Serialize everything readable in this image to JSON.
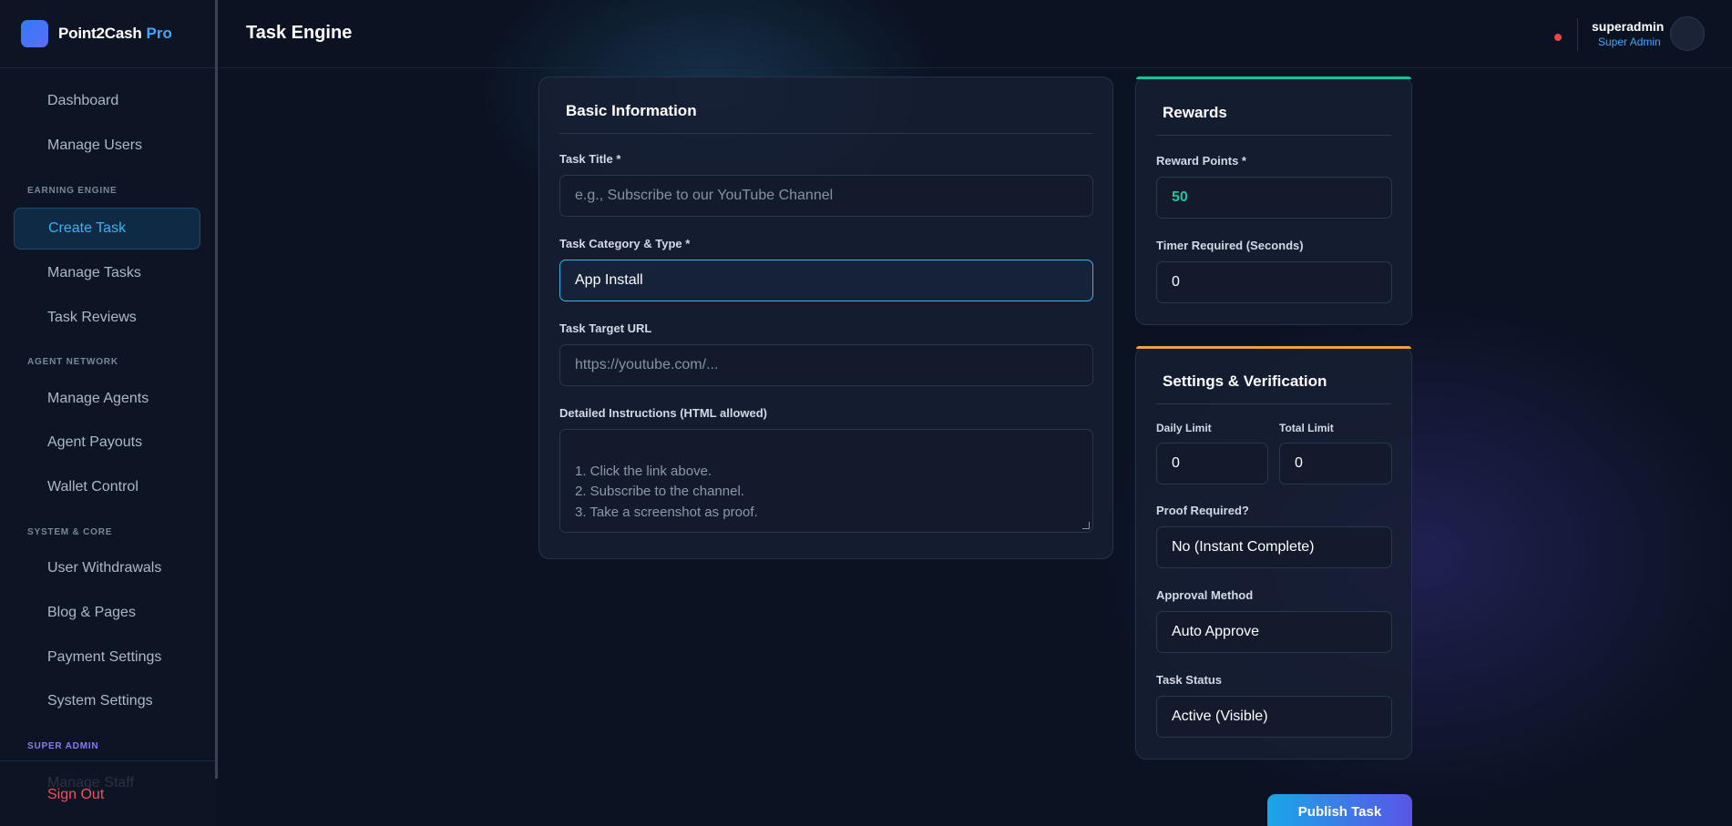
{
  "brand": {
    "name": "Point2Cash",
    "tag": "Pro"
  },
  "sidebar": {
    "items": [
      {
        "label": "Dashboard"
      },
      {
        "label": "Manage Users"
      },
      {
        "label": "Create Task"
      },
      {
        "label": "Manage Tasks"
      },
      {
        "label": "Task Reviews"
      },
      {
        "label": "Manage Agents"
      },
      {
        "label": "Agent Payouts"
      },
      {
        "label": "Wallet Control"
      },
      {
        "label": "User Withdrawals"
      },
      {
        "label": "Blog & Pages"
      },
      {
        "label": "Payment Settings"
      },
      {
        "label": "System Settings"
      }
    ],
    "sections": {
      "earning": "EARNING ENGINE",
      "agent": "AGENT NETWORK",
      "system": "SYSTEM & CORE",
      "super": "SUPER ADMIN"
    },
    "faded_item": "Manage Staff",
    "sign_out": "Sign Out"
  },
  "header": {
    "title": "Task Engine",
    "user_name": "superadmin",
    "user_role": "Super Admin"
  },
  "basic_info": {
    "title": "Basic Information",
    "task_title_label": "Task Title *",
    "task_title_placeholder": "e.g., Subscribe to our YouTube Channel",
    "category_label": "Task Category & Type *",
    "category_value": "App Install",
    "url_label": "Task Target URL",
    "url_placeholder": "https://youtube.com/...",
    "instructions_label": "Detailed Instructions (HTML allowed)",
    "instructions_placeholder": "1. Click the link above.\n2. Subscribe to the channel.\n3. Take a screenshot as proof."
  },
  "rewards": {
    "title": "Rewards",
    "points_label": "Reward Points *",
    "points_value": "50",
    "timer_label": "Timer Required (Seconds)",
    "timer_value": "0"
  },
  "settings": {
    "title": "Settings & Verification",
    "daily_limit_label": "Daily Limit",
    "daily_limit_value": "0",
    "total_limit_label": "Total Limit",
    "total_limit_value": "0",
    "proof_label": "Proof Required?",
    "proof_value": "No (Instant Complete)",
    "approval_label": "Approval Method",
    "approval_value": "Auto Approve",
    "status_label": "Task Status",
    "status_value": "Active (Visible)"
  },
  "actions": {
    "publish": "Publish Task"
  },
  "colors": {
    "accent": "#36b5f4",
    "reward": "#1fc79c",
    "danger": "#f0525b",
    "rewards_accent": "#17c39a",
    "settings_accent": "#f0a23a"
  }
}
